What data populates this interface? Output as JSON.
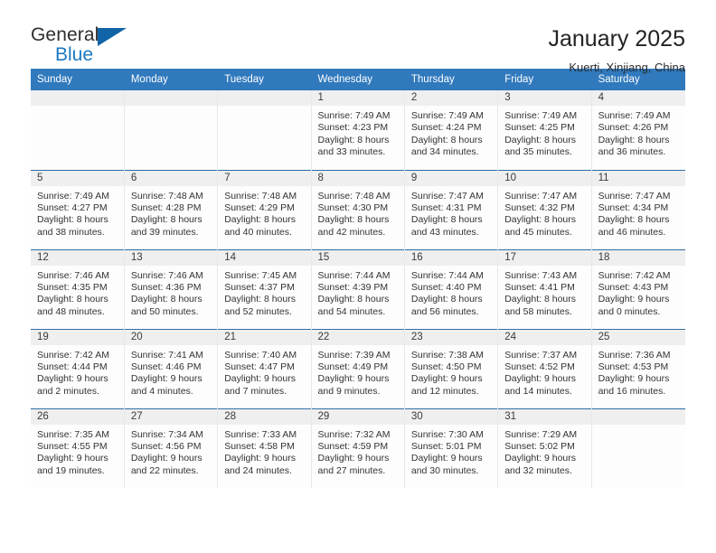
{
  "brand": {
    "name_part1": "General",
    "name_part2": "Blue",
    "triangle_color": "#1164a8",
    "blue_color": "#1b79c4"
  },
  "header": {
    "title": "January 2025",
    "subtitle": "Kuerti, Xinjiang, China"
  },
  "theme": {
    "header_row_bg": "#3079bd",
    "row_divider": "#2e6da4",
    "daynum_band_bg": "#efefef"
  },
  "weekdays": [
    "Sunday",
    "Monday",
    "Tuesday",
    "Wednesday",
    "Thursday",
    "Friday",
    "Saturday"
  ],
  "weeks": [
    [
      {
        "day": "",
        "lines": []
      },
      {
        "day": "",
        "lines": []
      },
      {
        "day": "",
        "lines": []
      },
      {
        "day": "1",
        "lines": [
          "Sunrise: 7:49 AM",
          "Sunset: 4:23 PM",
          "Daylight: 8 hours",
          "and 33 minutes."
        ]
      },
      {
        "day": "2",
        "lines": [
          "Sunrise: 7:49 AM",
          "Sunset: 4:24 PM",
          "Daylight: 8 hours",
          "and 34 minutes."
        ]
      },
      {
        "day": "3",
        "lines": [
          "Sunrise: 7:49 AM",
          "Sunset: 4:25 PM",
          "Daylight: 8 hours",
          "and 35 minutes."
        ]
      },
      {
        "day": "4",
        "lines": [
          "Sunrise: 7:49 AM",
          "Sunset: 4:26 PM",
          "Daylight: 8 hours",
          "and 36 minutes."
        ]
      }
    ],
    [
      {
        "day": "5",
        "lines": [
          "Sunrise: 7:49 AM",
          "Sunset: 4:27 PM",
          "Daylight: 8 hours",
          "and 38 minutes."
        ]
      },
      {
        "day": "6",
        "lines": [
          "Sunrise: 7:48 AM",
          "Sunset: 4:28 PM",
          "Daylight: 8 hours",
          "and 39 minutes."
        ]
      },
      {
        "day": "7",
        "lines": [
          "Sunrise: 7:48 AM",
          "Sunset: 4:29 PM",
          "Daylight: 8 hours",
          "and 40 minutes."
        ]
      },
      {
        "day": "8",
        "lines": [
          "Sunrise: 7:48 AM",
          "Sunset: 4:30 PM",
          "Daylight: 8 hours",
          "and 42 minutes."
        ]
      },
      {
        "day": "9",
        "lines": [
          "Sunrise: 7:47 AM",
          "Sunset: 4:31 PM",
          "Daylight: 8 hours",
          "and 43 minutes."
        ]
      },
      {
        "day": "10",
        "lines": [
          "Sunrise: 7:47 AM",
          "Sunset: 4:32 PM",
          "Daylight: 8 hours",
          "and 45 minutes."
        ]
      },
      {
        "day": "11",
        "lines": [
          "Sunrise: 7:47 AM",
          "Sunset: 4:34 PM",
          "Daylight: 8 hours",
          "and 46 minutes."
        ]
      }
    ],
    [
      {
        "day": "12",
        "lines": [
          "Sunrise: 7:46 AM",
          "Sunset: 4:35 PM",
          "Daylight: 8 hours",
          "and 48 minutes."
        ]
      },
      {
        "day": "13",
        "lines": [
          "Sunrise: 7:46 AM",
          "Sunset: 4:36 PM",
          "Daylight: 8 hours",
          "and 50 minutes."
        ]
      },
      {
        "day": "14",
        "lines": [
          "Sunrise: 7:45 AM",
          "Sunset: 4:37 PM",
          "Daylight: 8 hours",
          "and 52 minutes."
        ]
      },
      {
        "day": "15",
        "lines": [
          "Sunrise: 7:44 AM",
          "Sunset: 4:39 PM",
          "Daylight: 8 hours",
          "and 54 minutes."
        ]
      },
      {
        "day": "16",
        "lines": [
          "Sunrise: 7:44 AM",
          "Sunset: 4:40 PM",
          "Daylight: 8 hours",
          "and 56 minutes."
        ]
      },
      {
        "day": "17",
        "lines": [
          "Sunrise: 7:43 AM",
          "Sunset: 4:41 PM",
          "Daylight: 8 hours",
          "and 58 minutes."
        ]
      },
      {
        "day": "18",
        "lines": [
          "Sunrise: 7:42 AM",
          "Sunset: 4:43 PM",
          "Daylight: 9 hours",
          "and 0 minutes."
        ]
      }
    ],
    [
      {
        "day": "19",
        "lines": [
          "Sunrise: 7:42 AM",
          "Sunset: 4:44 PM",
          "Daylight: 9 hours",
          "and 2 minutes."
        ]
      },
      {
        "day": "20",
        "lines": [
          "Sunrise: 7:41 AM",
          "Sunset: 4:46 PM",
          "Daylight: 9 hours",
          "and 4 minutes."
        ]
      },
      {
        "day": "21",
        "lines": [
          "Sunrise: 7:40 AM",
          "Sunset: 4:47 PM",
          "Daylight: 9 hours",
          "and 7 minutes."
        ]
      },
      {
        "day": "22",
        "lines": [
          "Sunrise: 7:39 AM",
          "Sunset: 4:49 PM",
          "Daylight: 9 hours",
          "and 9 minutes."
        ]
      },
      {
        "day": "23",
        "lines": [
          "Sunrise: 7:38 AM",
          "Sunset: 4:50 PM",
          "Daylight: 9 hours",
          "and 12 minutes."
        ]
      },
      {
        "day": "24",
        "lines": [
          "Sunrise: 7:37 AM",
          "Sunset: 4:52 PM",
          "Daylight: 9 hours",
          "and 14 minutes."
        ]
      },
      {
        "day": "25",
        "lines": [
          "Sunrise: 7:36 AM",
          "Sunset: 4:53 PM",
          "Daylight: 9 hours",
          "and 16 minutes."
        ]
      }
    ],
    [
      {
        "day": "26",
        "lines": [
          "Sunrise: 7:35 AM",
          "Sunset: 4:55 PM",
          "Daylight: 9 hours",
          "and 19 minutes."
        ]
      },
      {
        "day": "27",
        "lines": [
          "Sunrise: 7:34 AM",
          "Sunset: 4:56 PM",
          "Daylight: 9 hours",
          "and 22 minutes."
        ]
      },
      {
        "day": "28",
        "lines": [
          "Sunrise: 7:33 AM",
          "Sunset: 4:58 PM",
          "Daylight: 9 hours",
          "and 24 minutes."
        ]
      },
      {
        "day": "29",
        "lines": [
          "Sunrise: 7:32 AM",
          "Sunset: 4:59 PM",
          "Daylight: 9 hours",
          "and 27 minutes."
        ]
      },
      {
        "day": "30",
        "lines": [
          "Sunrise: 7:30 AM",
          "Sunset: 5:01 PM",
          "Daylight: 9 hours",
          "and 30 minutes."
        ]
      },
      {
        "day": "31",
        "lines": [
          "Sunrise: 7:29 AM",
          "Sunset: 5:02 PM",
          "Daylight: 9 hours",
          "and 32 minutes."
        ]
      },
      {
        "day": "",
        "lines": []
      }
    ]
  ]
}
